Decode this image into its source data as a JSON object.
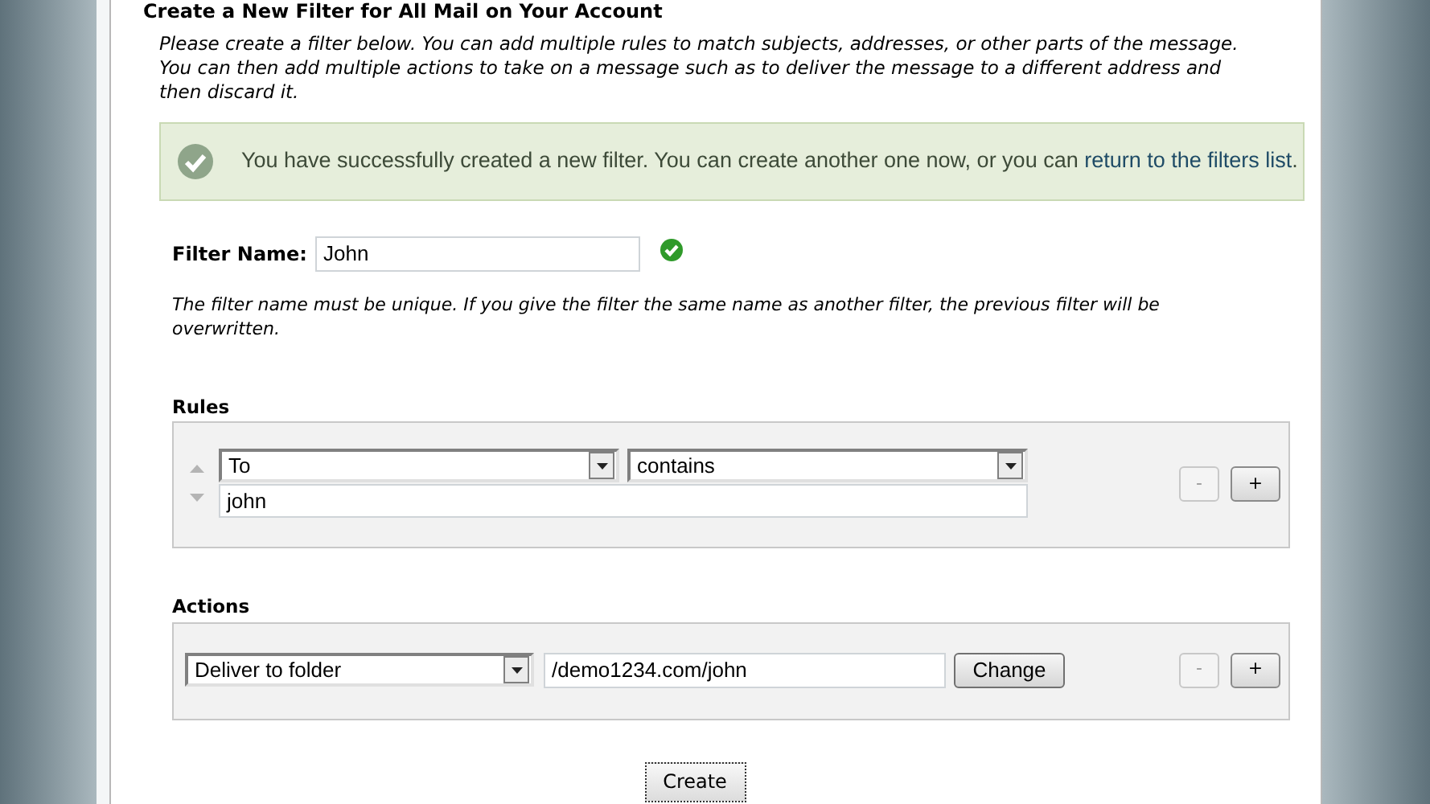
{
  "page_title": "Create a New Filter for All Mail on Your Account",
  "intro": "Please create a filter below. You can add multiple rules to match subjects, addresses, or other parts of the message. You can then add multiple actions to take on a message such as to deliver the message to a different address and then discard it.",
  "notice": {
    "text": "You have successfully created a new filter. You can create another one now, or you can ",
    "link": "return to the filters list",
    "tail": "."
  },
  "filter_name": {
    "label": "Filter Name:",
    "value": "John",
    "valid": true
  },
  "filter_help": "The filter name must be unique. If you give the filter the same name as another filter, the previous filter will be overwritten.",
  "rules": {
    "label": "Rules",
    "items": [
      {
        "field": "To",
        "operator": "contains",
        "value": "john",
        "up_disabled": true,
        "down_disabled": true,
        "remove_button": {
          "label": "-",
          "disabled": true
        },
        "add_button": {
          "label": "+",
          "disabled": false
        }
      }
    ]
  },
  "actions": {
    "label": "Actions",
    "items": [
      {
        "action": "Deliver to folder",
        "target": "/demo1234.com/john",
        "change_button": "Change",
        "remove_button": {
          "label": "-",
          "disabled": true
        },
        "add_button": {
          "label": "+",
          "disabled": false
        }
      }
    ]
  },
  "create_button": "Create"
}
